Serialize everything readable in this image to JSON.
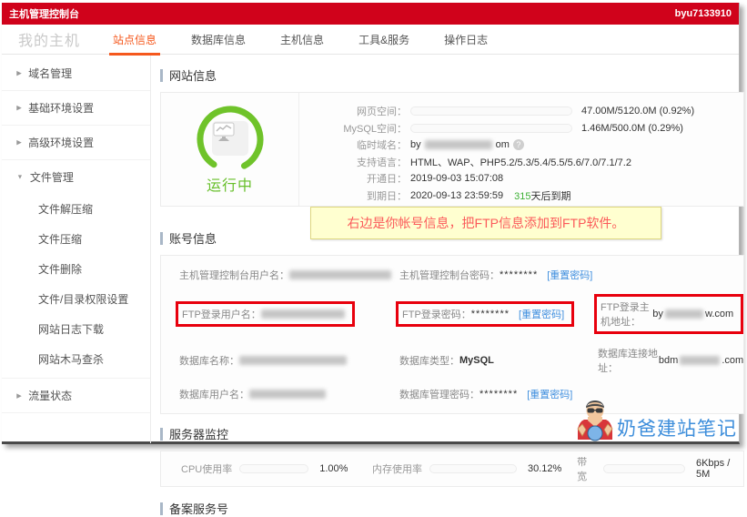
{
  "topbar": {
    "title": "主机管理控制台",
    "user": "byu7133910"
  },
  "tabbar": {
    "context_label": "我的主机",
    "tabs": [
      "站点信息",
      "数据库信息",
      "主机信息",
      "工具&服务",
      "操作日志"
    ]
  },
  "icons": {
    "collapsed": "▶",
    "expanded": "▼",
    "help": "?"
  },
  "sidebar": {
    "groups": [
      {
        "label": "域名管理",
        "expanded": false
      },
      {
        "label": "基础环境设置",
        "expanded": false
      },
      {
        "label": "高级环境设置",
        "expanded": false
      },
      {
        "label": "文件管理",
        "expanded": true,
        "children": [
          "文件解压缩",
          "文件压缩",
          "文件删除",
          "文件/目录权限设置",
          "网站日志下载",
          "网站木马查杀"
        ]
      },
      {
        "label": "流量状态",
        "expanded": false
      }
    ]
  },
  "site_info": {
    "title": "网站信息",
    "status_text": "运行中",
    "web_space": {
      "label": "网页空间：",
      "value": "47.00M/5120.0M (0.92%)",
      "percent": 0.92
    },
    "mysql_space": {
      "label": "MySQL空间：",
      "value": "1.46M/500.0M (0.29%)",
      "percent": 0.29
    },
    "temp_domain": {
      "label": "临时域名：",
      "prefix": "by",
      "suffix": "om"
    },
    "languages": {
      "label": "支持语言：",
      "value": "HTML、WAP、PHP5.2/5.3/5.4/5.5/5.6/7.0/7.1/7.2"
    },
    "open_date": {
      "label": "开通日：",
      "value": "2019-09-03 15:07:08"
    },
    "expire_date": {
      "label": "到期日：",
      "value": "2020-09-13 23:59:59",
      "days": "315",
      "days_suffix": "天后到期"
    }
  },
  "note": {
    "text": "右边是你帐号信息，把FTP信息添加到FTP软件。"
  },
  "account": {
    "title": "账号信息",
    "console_user_label": "主机管理控制台用户名：",
    "console_pwd_label": "主机管理控制台密码：",
    "ftp_user_label": "FTP登录用户名：",
    "ftp_pwd_label": "FTP登录密码：",
    "ftp_host_label": "FTP登录主机地址：",
    "ftp_host_prefix": "by",
    "ftp_host_suffix": "w.com",
    "db_name_label": "数据库名称：",
    "db_type_label": "数据库类型：",
    "db_type_value": "MySQL",
    "db_host_label": "数据库连接地址：",
    "db_host_prefix": "bdm",
    "db_host_suffix": ".com",
    "db_user_label": "数据库用户名：",
    "db_pwd_label": "数据库管理密码：",
    "password_mask": "********",
    "reset_link": "[重置密码]"
  },
  "monitor": {
    "title": "服务器监控",
    "cpu": {
      "label": "CPU使用率",
      "value": "1.00%",
      "percent": 1
    },
    "memory": {
      "label": "内存使用率",
      "value": "30.12%",
      "percent": 30.12
    },
    "bandwidth": {
      "label": "带宽",
      "value": "6Kbps / 5M",
      "percent": 0
    }
  },
  "beian": {
    "title": "备案服务号"
  },
  "watermark": {
    "text": "奶爸建站笔记"
  },
  "colors": {
    "topbar_red": "#d0021b",
    "active_tab_orange": "#f5581d",
    "status_green": "#6fc32a",
    "link_blue": "#3e8ede",
    "highlight_red": "#e8000d",
    "note_bg": "#ffffd0"
  }
}
